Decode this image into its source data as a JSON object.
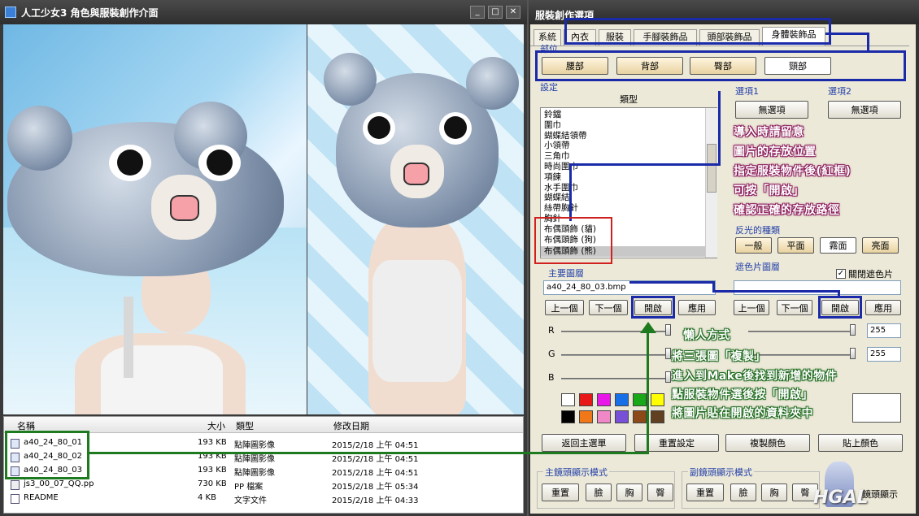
{
  "left_window": {
    "title": "人工少女3 角色與服裝創作介面",
    "min": "_",
    "max": "□",
    "close": "✕"
  },
  "file_list": {
    "headers": [
      "名稱",
      "大小",
      "類型",
      "修改日期"
    ],
    "rows": [
      {
        "name": "a40_24_80_01",
        "size": "193 KB",
        "type": "點陣圖影像",
        "date": "2015/2/18 上午 04:51"
      },
      {
        "name": "a40_24_80_02",
        "size": "193 KB",
        "type": "點陣圖影像",
        "date": "2015/2/18 上午 04:51"
      },
      {
        "name": "a40_24_80_03",
        "size": "193 KB",
        "type": "點陣圖影像",
        "date": "2015/2/18 上午 04:51"
      },
      {
        "name": "js3_00_07_QQ.pp",
        "size": "730 KB",
        "type": "PP 檔案",
        "date": "2015/2/18 上午 05:34"
      },
      {
        "name": "README",
        "size": "4 KB",
        "type": "文字文件",
        "date": "2015/2/18 上午 04:33"
      }
    ]
  },
  "right_window": {
    "title": "服裝創作選項",
    "tabs": [
      "系統",
      "內衣",
      "服裝",
      "手腳裝飾品",
      "頭部裝飾品",
      "身體裝飾品"
    ],
    "part_label": "部位",
    "parts": [
      "腰部",
      "背部",
      "臀部",
      "頸部"
    ],
    "settings_label": "設定",
    "type_header": "類型",
    "type_items": [
      "鈴鐺",
      "圍巾",
      "蝴蝶結領帶",
      "小領帶",
      "三角巾",
      "時尚圍巾",
      "項鍊",
      "水手圍巾",
      "蝴蝶結",
      "絲帶胸針",
      "胸針",
      "布偶頭飾 (貓)",
      "布偶頭飾 (狗)",
      "布偶頭飾 (熊)"
    ],
    "option1_label": "選項1",
    "option1_btn": "無選項",
    "option2_label": "選項2",
    "option2_btn": "無選項",
    "reflect_label": "反光的種類",
    "reflect_btns": [
      "一般",
      "平面",
      "霧面",
      "亮面"
    ],
    "main_layer_label": "主要圖層",
    "main_layer_file": "a40_24_80_03.bmp",
    "mask_layer_label": "遮色片圖層",
    "close_mask_label": "關閉遮色片",
    "prev": "上一個",
    "next": "下一個",
    "open": "開啟",
    "apply": "應用",
    "r": "R",
    "g": "G",
    "b": "B",
    "val1": "255",
    "val2": "255",
    "swatch_colors": [
      "#ffffff",
      "#e81818",
      "#e818e8",
      "#1870e8",
      "#18a818",
      "#ffff00",
      "#000000",
      "#f07818",
      "#f088c8",
      "#7850d8",
      "#8c4a18",
      "#604020"
    ],
    "back_main": "返回主選單",
    "reset": "重置設定",
    "copy_color": "複製顏色",
    "paste_color": "貼上顏色",
    "main_cam_label": "主鏡頭顯示模式",
    "sub_cam_label": "副鏡頭顯示模式",
    "cam_btns": [
      "重置",
      "臉",
      "胸",
      "臀"
    ],
    "sub_cam_tail": "鏡頭顯示"
  },
  "notes": {
    "purple": [
      "導入時請留意",
      "圖片的存放位置",
      "指定服裝物件後(紅框)",
      "可按「開啟」",
      "確認正確的存放路徑"
    ],
    "green": [
      "懶人方式",
      "將三張圖「複製」",
      "進入到Make後找到新增的物件",
      "點服裝物件選後按「開啟」",
      "將圖片貼在開啟的資料夾中"
    ]
  },
  "watermark": "HGAL"
}
